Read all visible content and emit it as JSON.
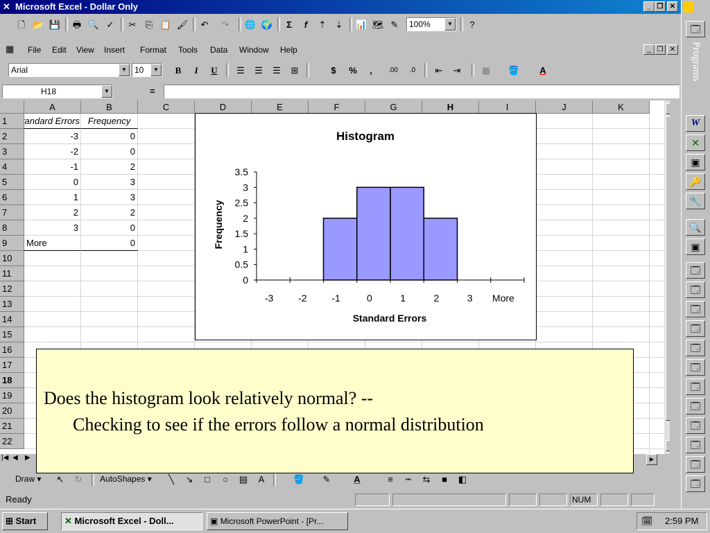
{
  "window": {
    "title": "Microsoft Excel - Dollar   Only"
  },
  "menu": [
    "File",
    "Edit",
    "View",
    "Insert",
    "Format",
    "Tools",
    "Data",
    "Window",
    "Help"
  ],
  "toolbar": {
    "zoom": "100%"
  },
  "format": {
    "font": "Arial",
    "size": "10",
    "bold": "B",
    "italic": "I",
    "underline": "U",
    "currency": "$",
    "percent": "%",
    "comma": ",",
    "inc_decimal": ".00",
    "dec_decimal": ".0",
    "font_color_label": "A"
  },
  "formula": {
    "name_box": "H18",
    "equals": "="
  },
  "columns": [
    "A",
    "B",
    "C",
    "D",
    "E",
    "F",
    "G",
    "H",
    "I",
    "J",
    "K"
  ],
  "rows": [
    "1",
    "2",
    "3",
    "4",
    "5",
    "6",
    "7",
    "8",
    "9",
    "10",
    "11",
    "12",
    "13",
    "14",
    "15",
    "16",
    "17",
    "18",
    "19",
    "20",
    "21",
    "22"
  ],
  "table": {
    "header_a": "Standard Errors",
    "header_b": "Frequency",
    "rows": [
      {
        "a": "-3",
        "b": "0"
      },
      {
        "a": "-2",
        "b": "0"
      },
      {
        "a": "-1",
        "b": "2"
      },
      {
        "a": "0",
        "b": "3"
      },
      {
        "a": "1",
        "b": "3"
      },
      {
        "a": "2",
        "b": "2"
      },
      {
        "a": "3",
        "b": "0"
      },
      {
        "a": "More",
        "b": "0"
      }
    ]
  },
  "chart_data": {
    "type": "bar",
    "title": "Histogram",
    "xlabel": "Standard Errors",
    "ylabel": "Frequency",
    "categories": [
      "-3",
      "-2",
      "-1",
      "0",
      "1",
      "2",
      "3",
      "More"
    ],
    "values": [
      0,
      0,
      2,
      3,
      3,
      2,
      0,
      0
    ],
    "ylim": [
      0,
      3.5
    ],
    "yticks": [
      "0",
      "0.5",
      "1",
      "1.5",
      "2",
      "2.5",
      "3",
      "3.5"
    ],
    "bar_color": "#9999ff",
    "grid": false,
    "legend": "none"
  },
  "callout": {
    "line1": "Does the histogram look relatively normal? --",
    "line2": "Checking to see if the errors follow a normal distribution"
  },
  "drawing": {
    "draw": "Draw",
    "autoshapes": "AutoShapes"
  },
  "status": {
    "ready": "Ready",
    "num": "NUM"
  },
  "taskbar": {
    "start": "Start",
    "excel": "Microsoft Excel - Doll...",
    "powerpoint": "Microsoft PowerPoint - [Pr...",
    "clock": "2:59 PM"
  },
  "office_bar": {
    "label": "Programs"
  }
}
